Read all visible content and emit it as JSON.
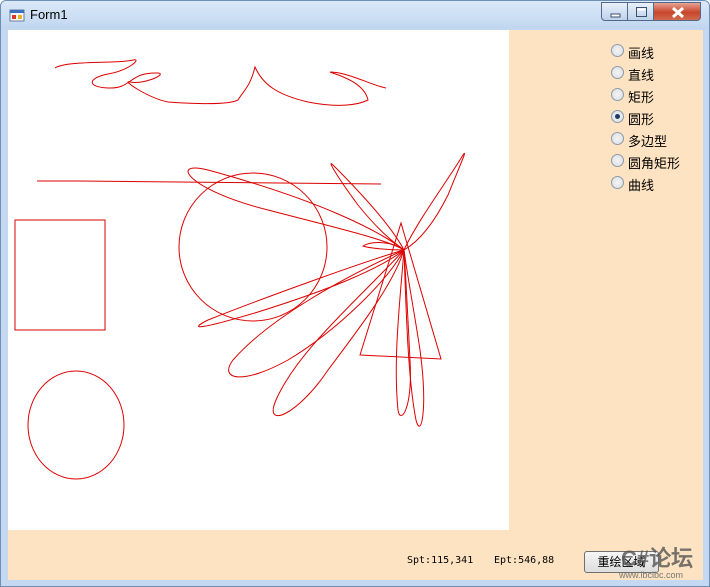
{
  "window": {
    "title": "Form1",
    "icon": "winforms-app-icon"
  },
  "title_buttons": {
    "minimize": "minimize-icon",
    "maximize": "maximize-icon",
    "close": "close-icon"
  },
  "shape_options": [
    {
      "label": "画线",
      "checked": false
    },
    {
      "label": "直线",
      "checked": false
    },
    {
      "label": "矩形",
      "checked": false
    },
    {
      "label": "圆形",
      "checked": true
    },
    {
      "label": "多边型",
      "checked": false
    },
    {
      "label": "圆角矩形",
      "checked": false
    },
    {
      "label": "曲线",
      "checked": false
    }
  ],
  "status": {
    "spt": "Spt:115,341",
    "ept": "Ept:546,88"
  },
  "redraw_button": {
    "label": "重绘区域"
  },
  "watermark": {
    "big": "C#论坛",
    "small": "www.ibcibc.com"
  },
  "colors": {
    "stroke": "#dd0000",
    "panel": "#fde3c2",
    "canvas": "#ffffff"
  }
}
